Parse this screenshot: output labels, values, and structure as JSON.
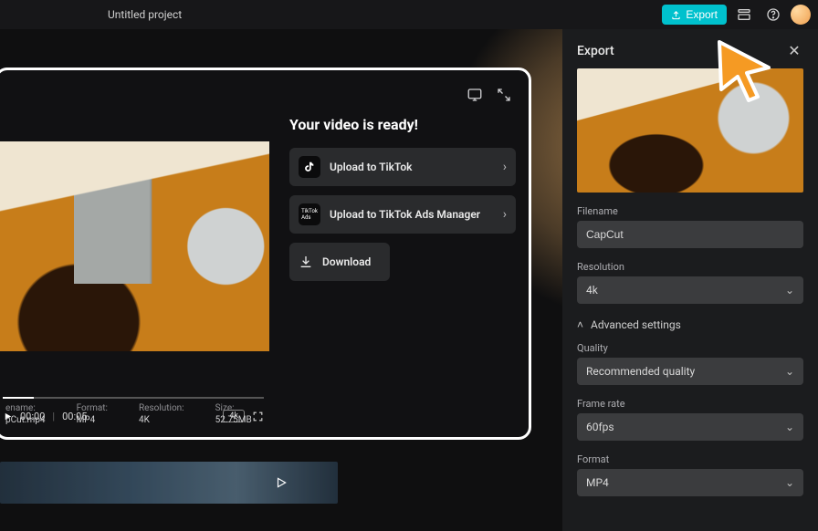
{
  "topbar": {
    "project_title": "Untitled project",
    "export_btn": "Export"
  },
  "export_panel": {
    "title": "Export",
    "filename_label": "Filename",
    "filename_value": "CapCut",
    "resolution_label": "Resolution",
    "resolution_value": "4k",
    "advanced_label": "Advanced settings",
    "quality_label": "Quality",
    "quality_value": "Recommended quality",
    "frame_rate_label": "Frame rate",
    "frame_rate_value": "60fps",
    "format_label": "Format",
    "format_value": "MP4"
  },
  "modal": {
    "title": "Your video is ready!",
    "upload_tiktok": "Upload to TikTok",
    "upload_ads": "Upload to TikTok Ads Manager",
    "download": "Download",
    "time_current": "00:00",
    "time_total": "00:05",
    "badge": "4k"
  },
  "meta": {
    "filename_k": "ename:",
    "filename_v": "pCut.mp4",
    "format_k": "Format:",
    "format_v": "MP4",
    "resolution_k": "Resolution:",
    "resolution_v": "4K",
    "size_k": "Size:",
    "size_v": "52.75MB"
  }
}
